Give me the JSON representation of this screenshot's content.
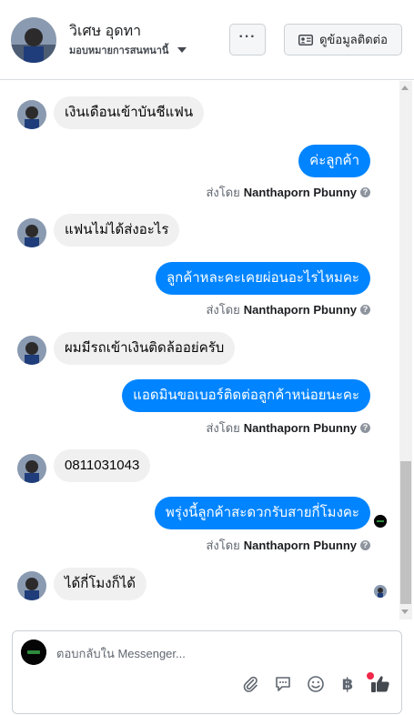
{
  "header": {
    "customer_name": "วิเศษ อุดทา",
    "assign_label": "มอบหมายการสนทนานี้",
    "more_label": "···",
    "profile_button_label": "ดูข้อมูลติดต่อ"
  },
  "messages": [
    {
      "direction": "in",
      "text": "เงินเดือนเข้าบันชีแฟน"
    },
    {
      "direction": "out",
      "text": "ค่ะลูกค้า",
      "sent_by_prefix": "ส่งโดย",
      "sent_by_name": "Nanthaporn Pbunny"
    },
    {
      "direction": "in",
      "text": "แฟนไม่ได้ส่งอะไร"
    },
    {
      "direction": "out",
      "text": "ลูกค้าหละคะเคยผ่อนอะไรไหมคะ",
      "sent_by_prefix": "ส่งโดย",
      "sent_by_name": "Nanthaporn Pbunny"
    },
    {
      "direction": "in",
      "text": "ผมมีรถเข้าเงินติดล้ออย่ครับ"
    },
    {
      "direction": "out",
      "text": "แอดมินขอเบอร์ติดต่อลูกค้าหน่อยนะคะ",
      "sent_by_prefix": "ส่งโดย",
      "sent_by_name": "Nanthaporn Pbunny"
    },
    {
      "direction": "in",
      "text": "0811031043"
    },
    {
      "direction": "out",
      "text": "พรุ่งนี้ลูกค้าสะดวกรับสายกี่โมงคะ",
      "sent_by_prefix": "ส่งโดย",
      "sent_by_name": "Nanthaporn Pbunny"
    },
    {
      "direction": "in",
      "text": "ได้กี่โมงก็ได้"
    }
  ],
  "composer": {
    "placeholder": "ตอบกลับใน Messenger...",
    "tools": [
      "paperclip-icon",
      "chat-bubble-icon",
      "smiley-icon",
      "baht-icon",
      "thumbs-up-icon"
    ],
    "baht_symbol": "฿"
  },
  "colors": {
    "outgoing_bubble": "#0084ff",
    "incoming_bubble": "#f0f0f0",
    "thumbs_up": "#444950",
    "notification_dot": "#f02849"
  }
}
